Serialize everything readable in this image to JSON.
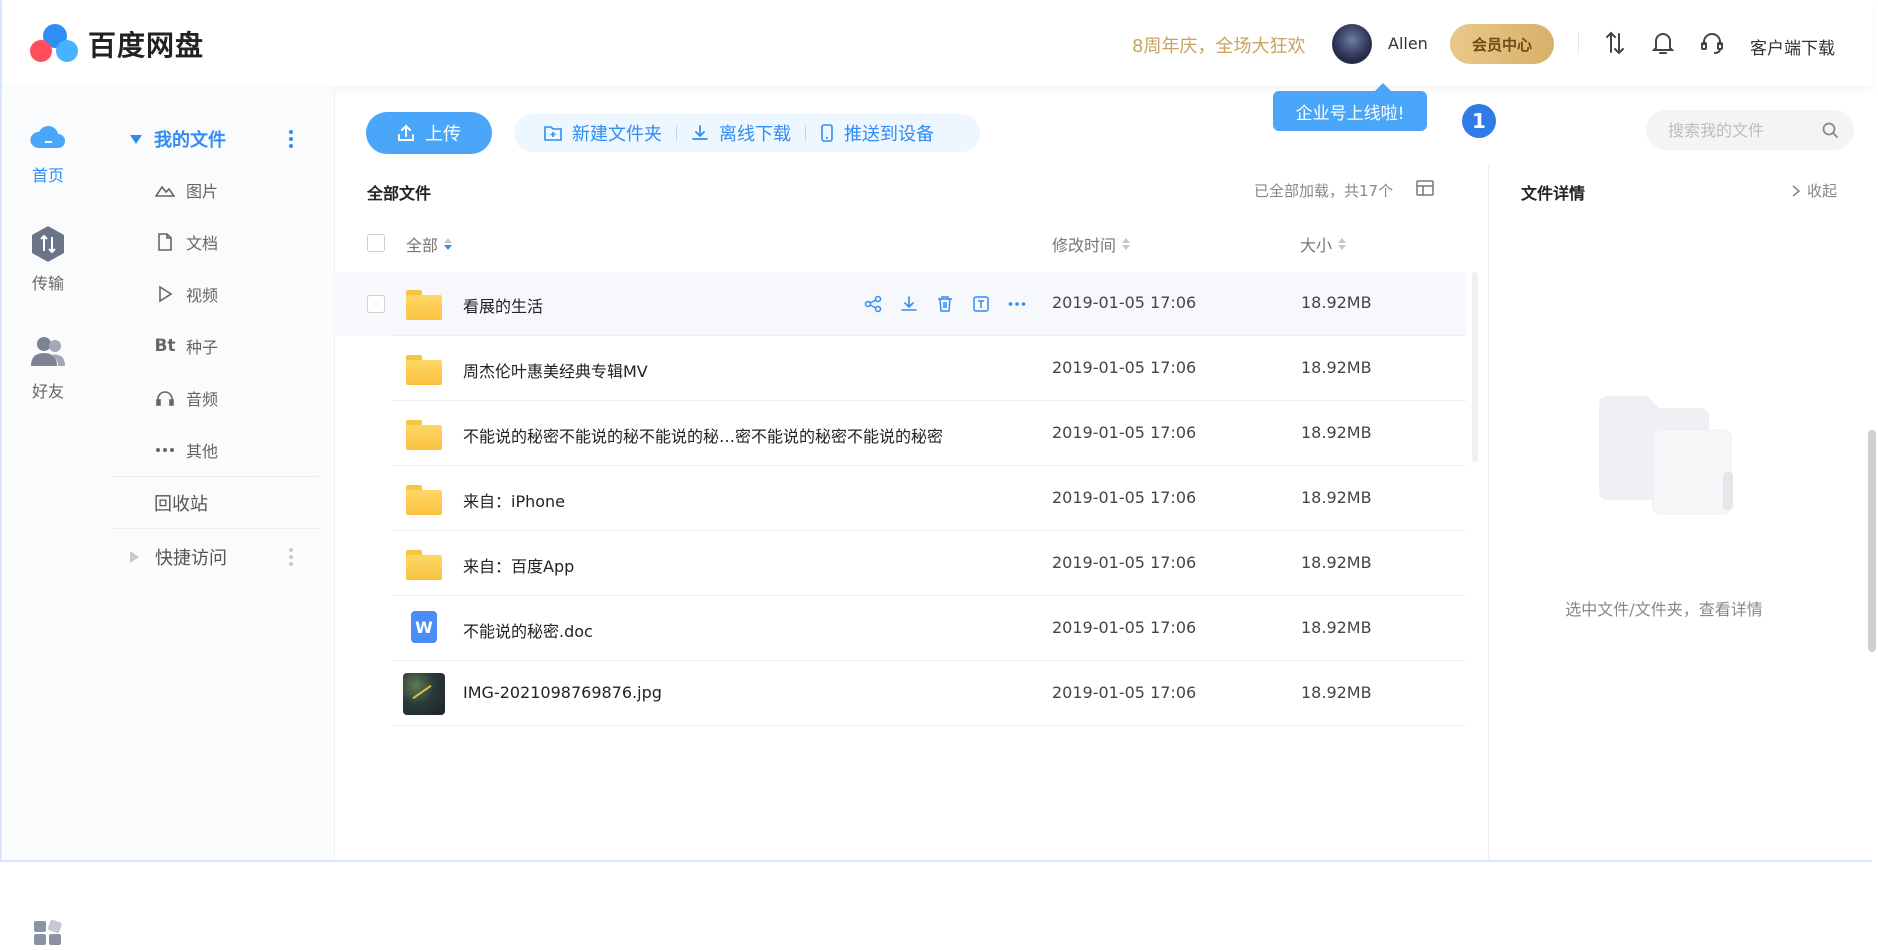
{
  "app": {
    "name": "百度网盘"
  },
  "header": {
    "promo": "8周年庆，全场大狂欢",
    "username": "Allen",
    "vip_label": "会员中心",
    "client_download": "客户端下载",
    "tooltip": "企业号上线啦!",
    "step_badge": "1"
  },
  "rail": {
    "items": [
      {
        "label": "首页",
        "icon": "cloud-home-icon",
        "active": true
      },
      {
        "label": "传输",
        "icon": "transfer-icon",
        "active": false
      },
      {
        "label": "好友",
        "icon": "friends-icon",
        "active": false
      }
    ]
  },
  "sidebar": {
    "my_files": "我的文件",
    "categories": [
      {
        "label": "图片",
        "icon": "image-icon"
      },
      {
        "label": "文档",
        "icon": "document-icon"
      },
      {
        "label": "视频",
        "icon": "video-icon"
      },
      {
        "label": "种子",
        "icon": "bt-icon",
        "icon_text": "Bt"
      },
      {
        "label": "音频",
        "icon": "headphones-icon"
      },
      {
        "label": "其他",
        "icon": "more-icon"
      }
    ],
    "recycle_bin": "回收站",
    "quick_access": "快捷访问"
  },
  "toolbar": {
    "upload": "上传",
    "new_folder": "新建文件夹",
    "offline_download": "离线下载",
    "push_to_device": "推送到设备",
    "search_placeholder": "搜索我的文件"
  },
  "files": {
    "breadcrumb": "全部文件",
    "loaded_status": "已全部加载，共17个",
    "columns": {
      "name": "全部",
      "modified": "修改时间",
      "size": "大小"
    },
    "rows": [
      {
        "name": "看展的生活",
        "type": "folder",
        "modified": "2019-01-05 17:06",
        "size": "18.92MB"
      },
      {
        "name": "周杰伦叶惠美经典专辑MV",
        "type": "folder",
        "modified": "2019-01-05 17:06",
        "size": "18.92MB"
      },
      {
        "name": "不能说的秘密不能说的秘不能说的秘…密不能说的秘密不能说的秘密",
        "type": "folder",
        "modified": "2019-01-05 17:06",
        "size": "18.92MB"
      },
      {
        "name": "来自：iPhone",
        "type": "folder",
        "modified": "2019-01-05 17:06",
        "size": "18.92MB"
      },
      {
        "name": "来自：百度App",
        "type": "folder",
        "modified": "2019-01-05 17:06",
        "size": "18.92MB"
      },
      {
        "name": "不能说的秘密.doc",
        "type": "doc",
        "icon_text": "W",
        "modified": "2019-01-05 17:06",
        "size": "18.92MB"
      },
      {
        "name": "IMG-2021098769876.jpg",
        "type": "image",
        "modified": "2019-01-05 17:06",
        "size": "18.92MB"
      }
    ]
  },
  "details": {
    "title": "文件详情",
    "collapse": "收起",
    "hint": "选中文件/文件夹，查看详情"
  },
  "colors": {
    "accent": "#2f8df4",
    "upload": "#4aa6f8",
    "promo": "#c8a460",
    "vip_gold": "#d8b06a"
  }
}
